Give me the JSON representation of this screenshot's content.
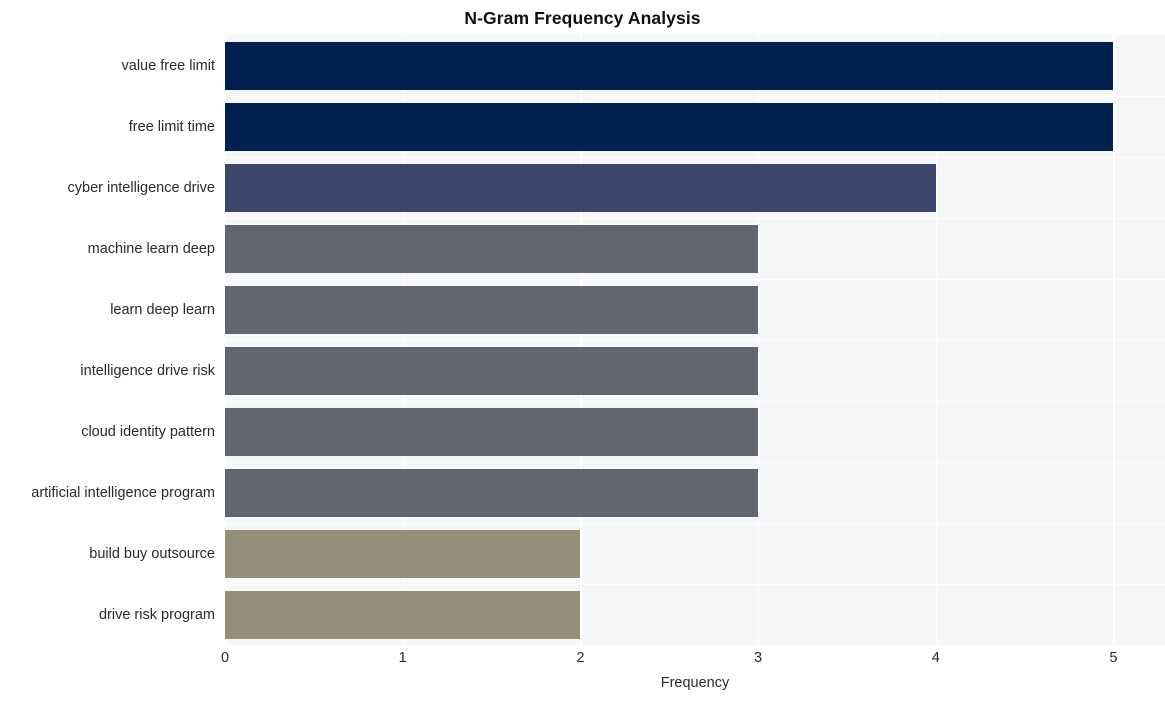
{
  "chart_data": {
    "type": "bar",
    "orientation": "horizontal",
    "title": "N-Gram Frequency Analysis",
    "xlabel": "Frequency",
    "ylabel": "",
    "categories": [
      "value free limit",
      "free limit time",
      "cyber intelligence drive",
      "machine learn deep",
      "learn deep learn",
      "intelligence drive risk",
      "cloud identity pattern",
      "artificial intelligence program",
      "build buy outsource",
      "drive risk program"
    ],
    "values": [
      5,
      5,
      4,
      3,
      3,
      3,
      3,
      3,
      2,
      2
    ],
    "bar_colors": [
      "#002050",
      "#002050",
      "#3a4569",
      "#63666e",
      "#63666e",
      "#63666e",
      "#63666e",
      "#63666e",
      "#948f78",
      "#948f78"
    ],
    "xlim": [
      0,
      5.29
    ],
    "xticks": [
      0,
      1,
      2,
      3,
      4,
      5
    ],
    "xtick_labels": [
      "0",
      "1",
      "2",
      "3",
      "4",
      "5"
    ],
    "grid": true,
    "grid_color": "#ffffff",
    "plot_background": "#f6f7f8",
    "figure_background": "#ffffff",
    "legend": null
  }
}
